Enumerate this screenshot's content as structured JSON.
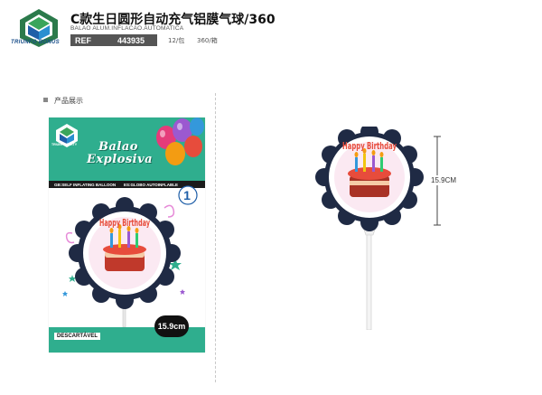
{
  "header": {
    "logo_text": "TRIUNFO BONUS",
    "title": "C款生日圆形自动充气铝膜气球/360",
    "subtitle": "BALAO ALUM.INFLACAO.AUTOMATICA",
    "ref_label": "REF",
    "ref_code": "443935",
    "pack_qty": "12/包",
    "box_qty": "360/箱"
  },
  "section": {
    "title": "产品展示"
  },
  "package": {
    "brand": "TRIUNFO PARTY",
    "title_line1": "Balao",
    "title_line2": "Explosiva",
    "strip_left": "GB:SELF INFLATING BALLOON",
    "strip_right": "ES:GLOBO AUTOINFLABLE",
    "badge": "1",
    "disposable_label": "DESCARTÁVEL",
    "size_label": "15.9cm",
    "balloon_text": "Happy Birthday"
  },
  "product": {
    "dimension_label": "15.9CM",
    "balloon_text": "Happy Birthday"
  },
  "colors": {
    "package_green": "#2fae8e",
    "dark_strip": "#1b1b1b",
    "ref_bg": "#555555"
  }
}
